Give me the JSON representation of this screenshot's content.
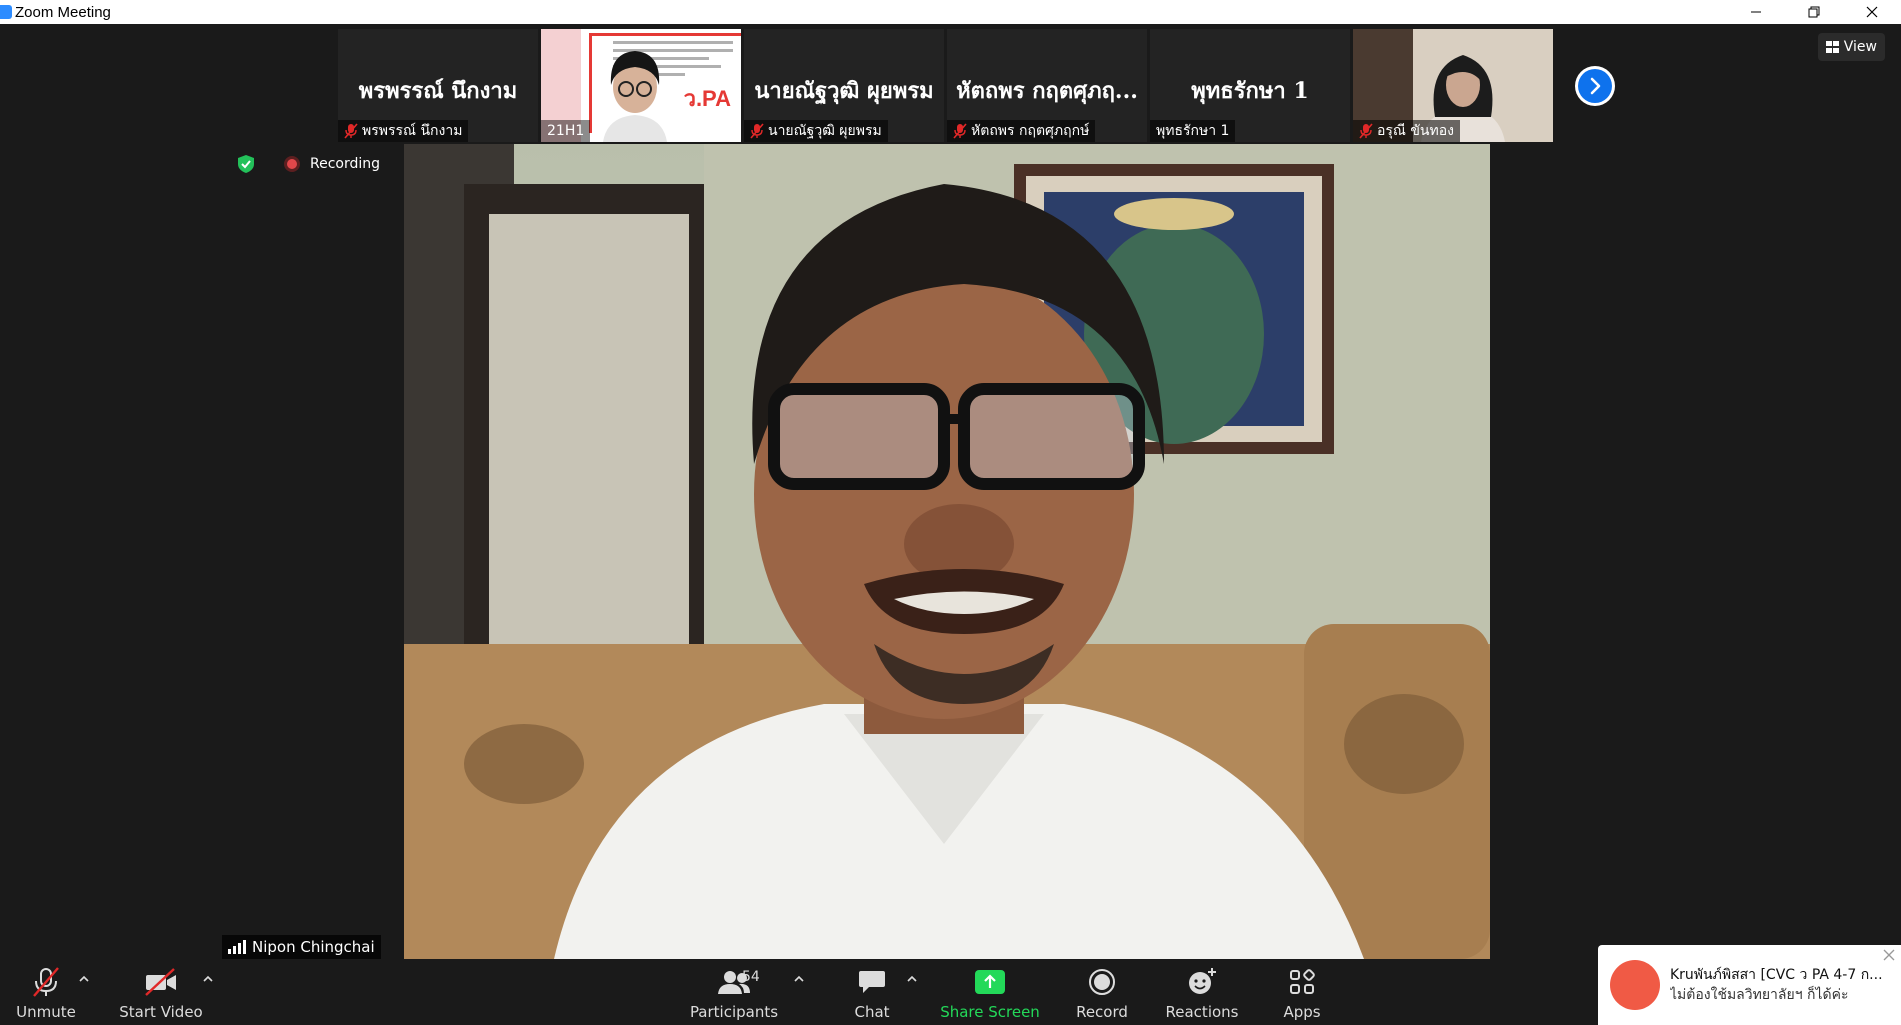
{
  "window": {
    "title": "Zoom Meeting"
  },
  "strip": {
    "tiles": [
      {
        "big_name": "พรพรรณ์ นึกงาม",
        "caption": "พรพรรณ์ นึกงาม",
        "muted": true,
        "video": false
      },
      {
        "big_name": "",
        "caption": "21H1",
        "muted": false,
        "video": true,
        "slide_text": "ว.PA"
      },
      {
        "big_name": "นายณัฐวุฒิ ผุยพรม",
        "caption": "นายณัฐวุฒิ ผุยพรม",
        "muted": true,
        "video": false
      },
      {
        "big_name": "หัตถพร กฤตศุภฤ...",
        "caption": "หัตถพร กฤตศุภฤกษ์",
        "muted": true,
        "video": false
      },
      {
        "big_name": "พุทธรักษา 1",
        "caption": "พุทธรักษา 1",
        "muted": false,
        "video": false
      },
      {
        "big_name": "",
        "caption": "อรุณี ขันทอง",
        "muted": true,
        "video": true
      }
    ],
    "next_icon": "chevron-right-icon"
  },
  "view": {
    "label": "View",
    "icon": "grid-view-icon"
  },
  "status": {
    "recording_label": "Recording"
  },
  "speaker": {
    "name": "Nipon Chingchai"
  },
  "toolbar": {
    "unmute": "Unmute",
    "start_video": "Start Video",
    "participants": "Participants",
    "participants_count": "54",
    "chat": "Chat",
    "share_screen": "Share Screen",
    "record": "Record",
    "reactions": "Reactions",
    "apps": "Apps"
  },
  "notification": {
    "sender": "Kruพันภ์พิสสา [CVC ว PA 4-7 ก...",
    "message": "ไม่ต้องใช้มลวิทยาลัยฯ ก็ได้ค่ะ"
  },
  "colors": {
    "accent_blue": "#0e72ed",
    "share_green": "#23d959",
    "recording_red": "#e0474a",
    "mute_red": "#e02828"
  }
}
